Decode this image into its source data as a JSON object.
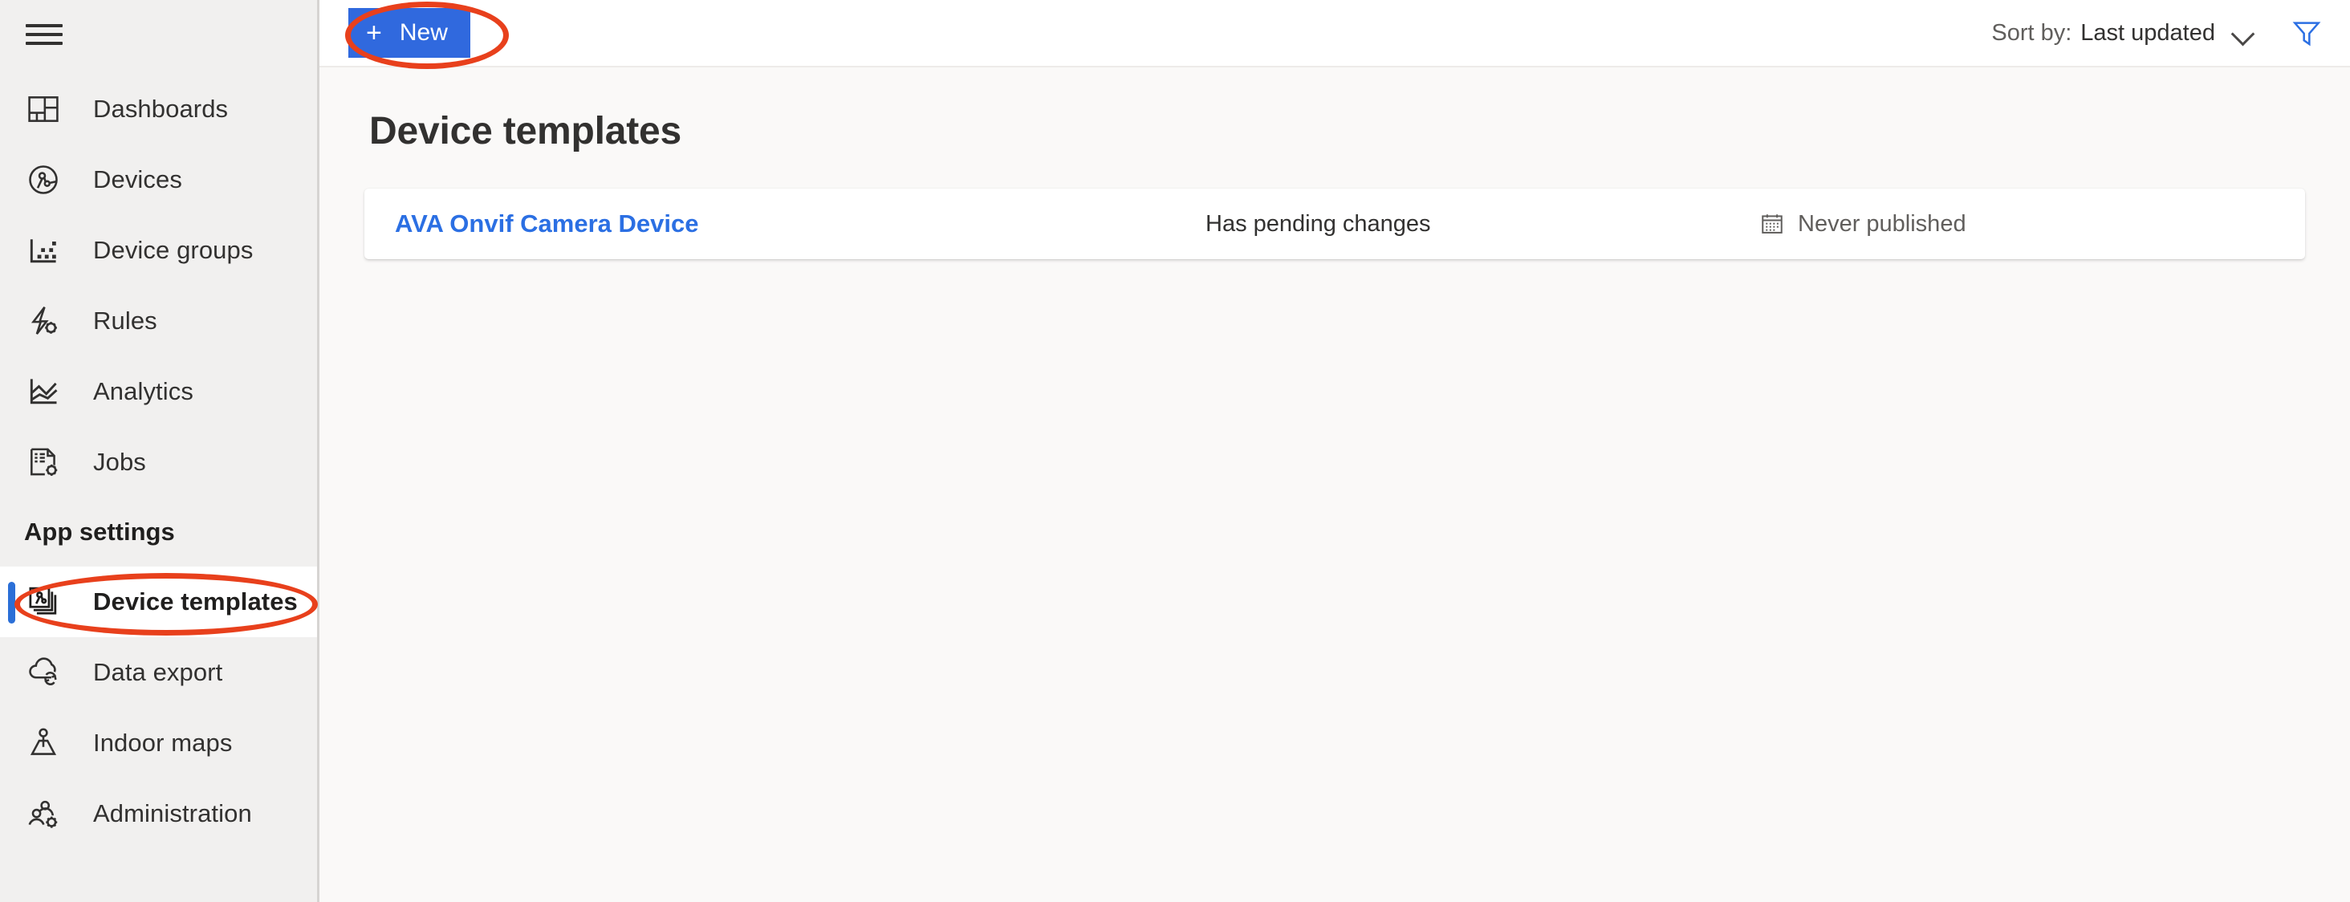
{
  "sidebar": {
    "menu_icon": "hamburger-icon",
    "items": [
      {
        "label": "Dashboards",
        "icon": "dashboards-icon",
        "selected": false
      },
      {
        "label": "Devices",
        "icon": "devices-icon",
        "selected": false
      },
      {
        "label": "Device groups",
        "icon": "device-groups-icon",
        "selected": false
      },
      {
        "label": "Rules",
        "icon": "rules-icon",
        "selected": false
      },
      {
        "label": "Analytics",
        "icon": "analytics-icon",
        "selected": false
      },
      {
        "label": "Jobs",
        "icon": "jobs-icon",
        "selected": false
      }
    ],
    "section_label": "App settings",
    "settings_items": [
      {
        "label": "Device templates",
        "icon": "device-templates-icon",
        "selected": true
      },
      {
        "label": "Data export",
        "icon": "data-export-icon",
        "selected": false
      },
      {
        "label": "Indoor maps",
        "icon": "indoor-maps-icon",
        "selected": false
      },
      {
        "label": "Administration",
        "icon": "administration-icon",
        "selected": false
      }
    ]
  },
  "commandbar": {
    "new_button_label": "New",
    "new_button_icon": "plus-icon",
    "sort_label": "Sort by:",
    "sort_value": "Last updated",
    "sort_chevron_icon": "chevron-down-icon",
    "filter_icon": "filter-funnel-icon"
  },
  "main": {
    "page_title": "Device templates",
    "templates": [
      {
        "name": "AVA Onvif Camera Device",
        "status": "Has pending changes",
        "published": "Never published",
        "published_icon": "calendar-icon"
      }
    ]
  },
  "annotations": {
    "color": "#E8401C",
    "highlights": [
      "new-button",
      "device-templates-nav-item"
    ]
  },
  "colors": {
    "accent_blue": "#3069DE",
    "link_blue": "#2B6FE3",
    "sidebar_bg": "#F1F0EF",
    "main_bg": "#FAF9F8",
    "annotation_red": "#E8401C",
    "selected_bar": "#2B6FD7"
  }
}
